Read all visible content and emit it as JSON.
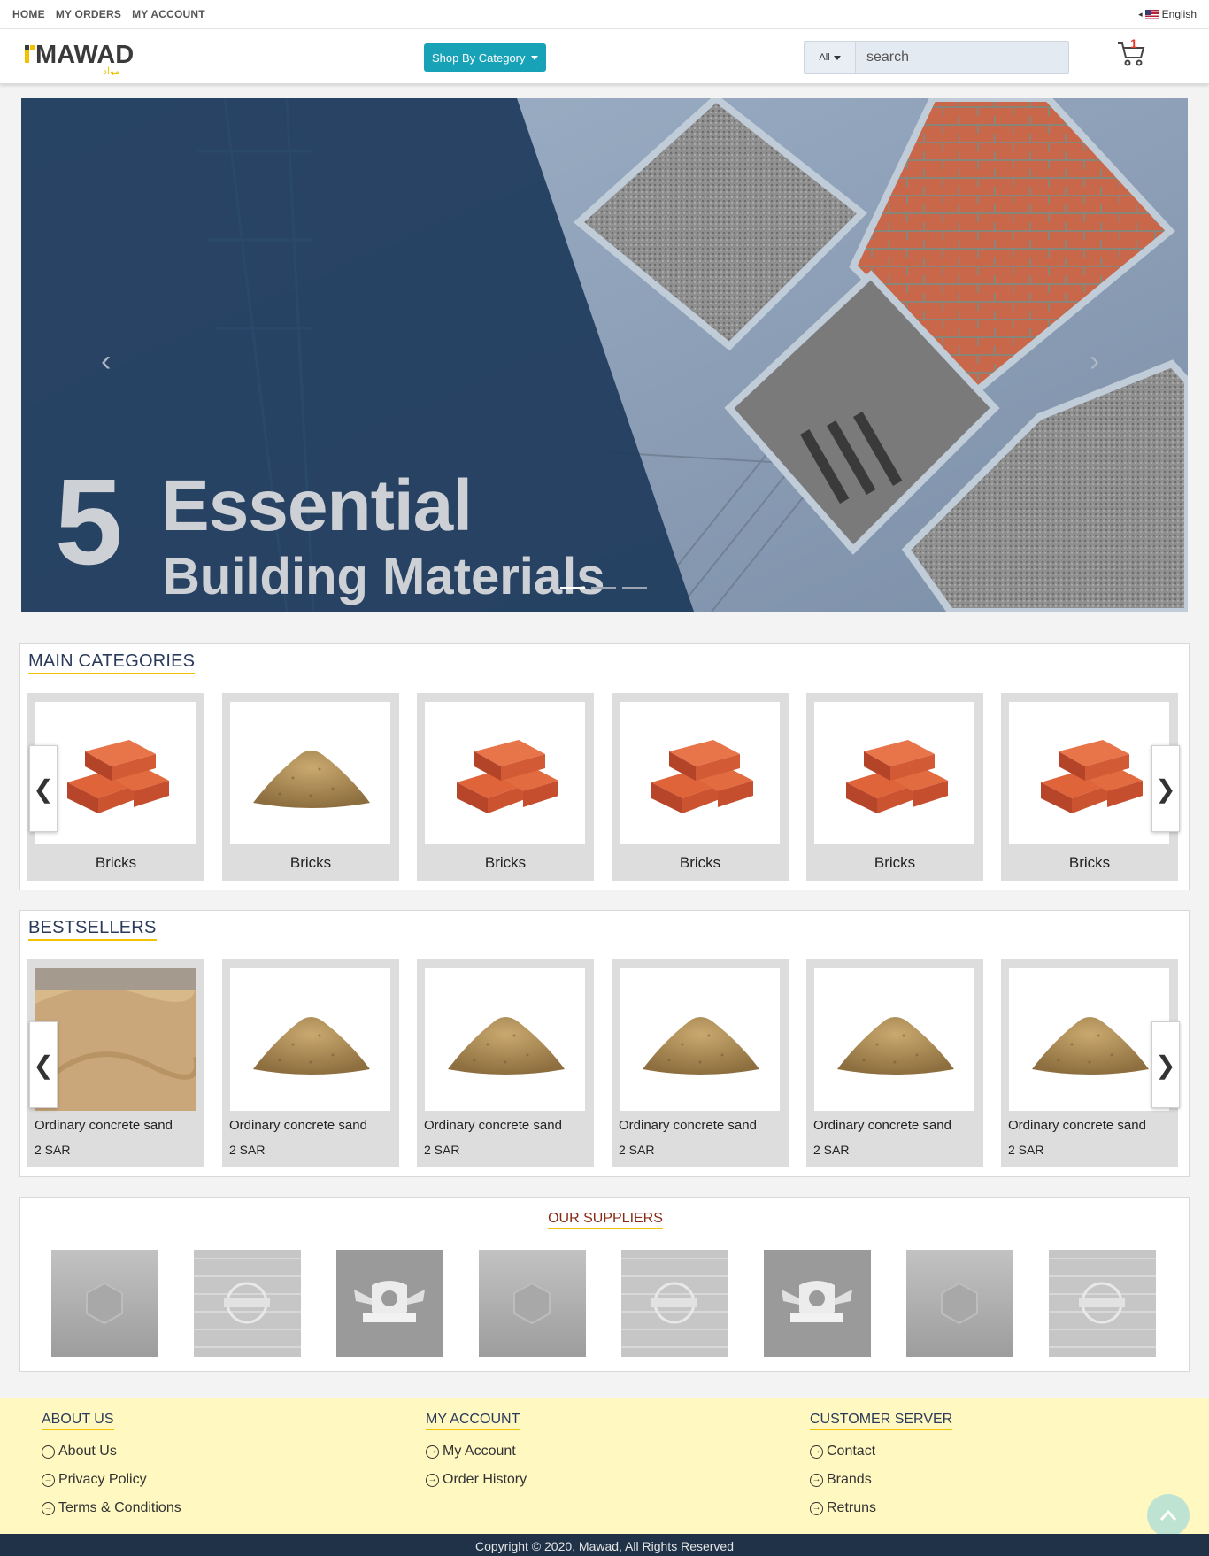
{
  "topbar": {
    "nav": [
      "HOME",
      "MY ORDERS",
      "MY ACCOUNT"
    ],
    "language": "English"
  },
  "header": {
    "logo_text": "MAWAD",
    "logo_arabic": "مواد",
    "shop_by_category": "Shop By Category",
    "search_scope": "All",
    "search_placeholder": "search",
    "cart_count": "1"
  },
  "hero": {
    "number": "5",
    "line1": "Essential",
    "line2": "Building Materials",
    "prev_icon": "chevron-left",
    "next_icon": "chevron-right",
    "slide_count": 3,
    "active_slide": 1
  },
  "main_categories": {
    "title": "MAIN CATEGORIES",
    "items": [
      {
        "name": "Bricks",
        "image": "bricks"
      },
      {
        "name": "Bricks",
        "image": "sand"
      },
      {
        "name": "Bricks",
        "image": "bricks"
      },
      {
        "name": "Bricks",
        "image": "bricks"
      },
      {
        "name": "Bricks",
        "image": "bricks"
      },
      {
        "name": "Bricks",
        "image": "bricks"
      }
    ]
  },
  "bestsellers": {
    "title": "BESTSELLERS",
    "items": [
      {
        "name": "Ordinary concrete sand",
        "price": "2 SAR",
        "image": "sand-photo"
      },
      {
        "name": "Ordinary concrete sand",
        "price": "2 SAR",
        "image": "sand"
      },
      {
        "name": "Ordinary concrete sand",
        "price": "2 SAR",
        "image": "sand"
      },
      {
        "name": "Ordinary concrete sand",
        "price": "2 SAR",
        "image": "sand"
      },
      {
        "name": "Ordinary concrete sand",
        "price": "2 SAR",
        "image": "sand"
      },
      {
        "name": "Ordinary concrete sand",
        "price": "2 SAR",
        "image": "sand"
      }
    ]
  },
  "suppliers": {
    "title": "OUR SUPPLIERS",
    "logos": [
      "design-badge",
      "vintage-badge",
      "football-club",
      "design-badge",
      "vintage-badge",
      "football-club",
      "design-badge",
      "vintage-badge"
    ]
  },
  "footer": {
    "about": {
      "title": "ABOUT US",
      "links": [
        "About Us",
        "Privacy Policy",
        "Terms & Conditions"
      ]
    },
    "account": {
      "title": "MY ACCOUNT",
      "links": [
        "My Account",
        "Order History"
      ]
    },
    "customer": {
      "title": "CUSTOMER SERVER",
      "links": [
        "Contact",
        "Brands",
        "Retruns"
      ]
    },
    "copyright": "Copyright © 2020, Mawad, All Rights Reserved"
  },
  "colors": {
    "accent": "#17a2b8",
    "brand_yellow": "#f2c200",
    "navy": "#1f3248",
    "footer_bg": "#fff8c0"
  }
}
